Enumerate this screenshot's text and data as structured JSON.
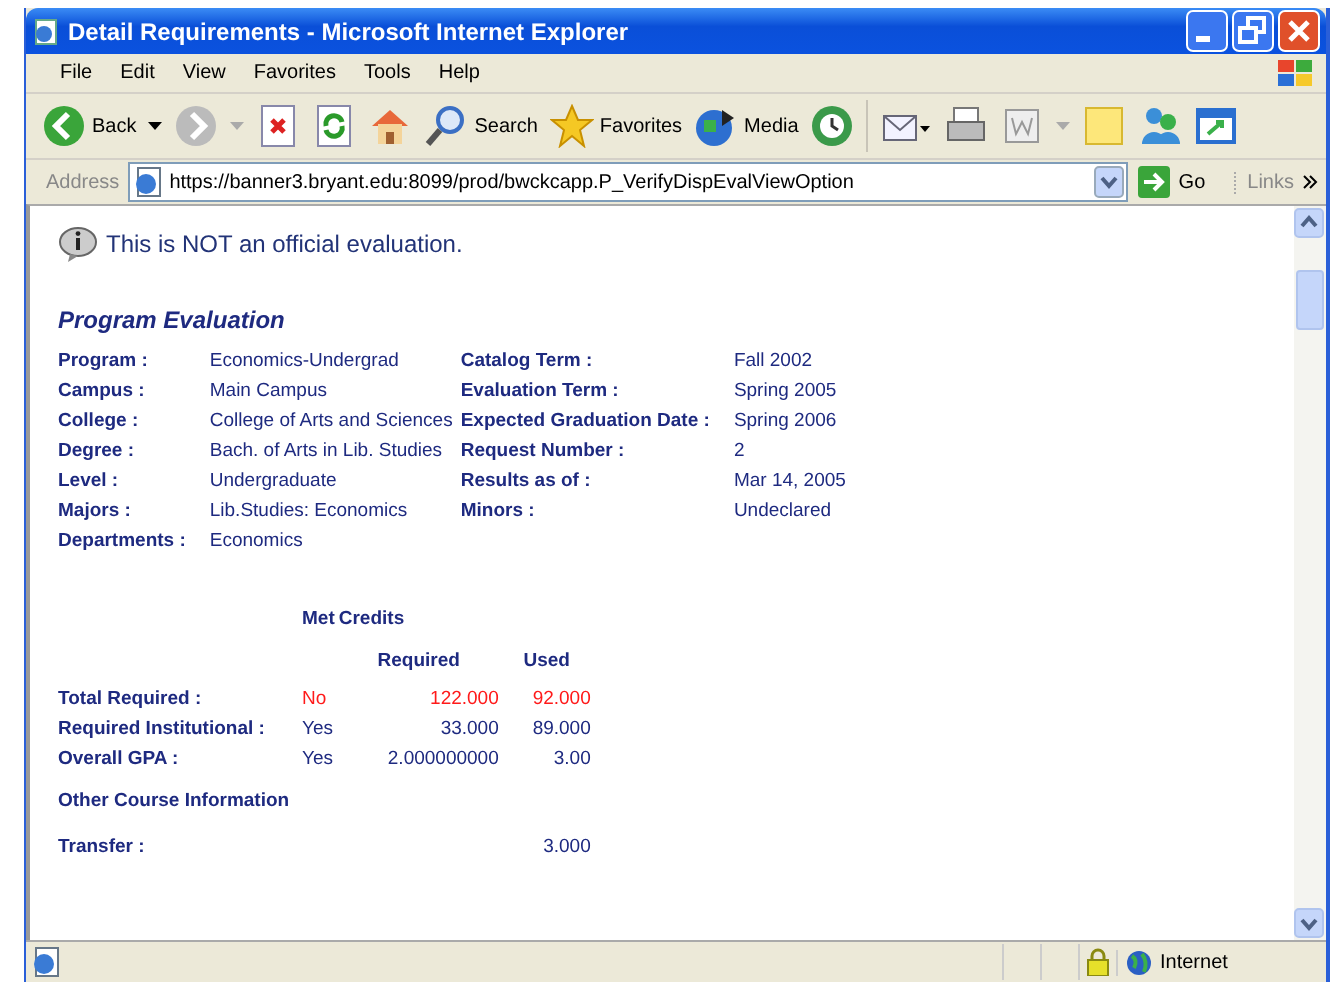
{
  "window": {
    "title": "Detail Requirements - Microsoft Internet Explorer"
  },
  "menu": [
    "File",
    "Edit",
    "View",
    "Favorites",
    "Tools",
    "Help"
  ],
  "toolbar": [
    {
      "kind": "back",
      "label": "Back"
    },
    {
      "kind": "forward"
    },
    {
      "kind": "stop"
    },
    {
      "kind": "refresh"
    },
    {
      "kind": "home"
    },
    {
      "kind": "search",
      "label": "Search"
    },
    {
      "kind": "favorites",
      "label": "Favorites"
    },
    {
      "kind": "media",
      "label": "Media"
    },
    {
      "kind": "history"
    },
    {
      "kind": "mail"
    },
    {
      "kind": "print"
    },
    {
      "kind": "edit"
    },
    {
      "kind": "note"
    },
    {
      "kind": "messenger"
    },
    {
      "kind": "window"
    }
  ],
  "address_bar": {
    "label": "Address",
    "value": "https://banner3.bryant.edu:8099/prod/bwckcapp.P_VerifyDispEvalViewOption",
    "go": "Go",
    "links": "Links"
  },
  "notice": "This is NOT an official evaluation.",
  "section_title": "Program Evaluation",
  "details": [
    {
      "label": "Program :",
      "value": "Economics-Undergrad",
      "label2": "Catalog Term :",
      "value2": "Fall 2002"
    },
    {
      "label": "Campus :",
      "value": "Main Campus",
      "label2": "Evaluation Term :",
      "value2": "Spring 2005"
    },
    {
      "label": "College :",
      "value": "College of Arts and Sciences",
      "label2": "Expected Graduation Date :",
      "value2": "Spring 2006"
    },
    {
      "label": "Degree :",
      "value": "Bach. of Arts in Lib. Studies",
      "label2": "Request Number :",
      "value2": "2"
    },
    {
      "label": "Level :",
      "value": "Undergraduate",
      "label2": "Results as of :",
      "value2": "Mar 14, 2005"
    },
    {
      "label": "Majors :",
      "value": "Lib.Studies: Economics",
      "label2": "Minors :",
      "value2": "Undeclared"
    },
    {
      "label": "Departments :",
      "value": "Economics"
    }
  ],
  "credits": {
    "headers": {
      "met": "Met",
      "credits": "Credits",
      "required": "Required",
      "used": "Used"
    },
    "rows": [
      {
        "label": "Total Required :",
        "met": "No",
        "required": "122.000",
        "used": "92.000",
        "failed": true
      },
      {
        "label": "Required Institutional :",
        "met": "Yes",
        "required": "33.000",
        "used": "89.000",
        "failed": false
      },
      {
        "label": "Overall GPA :",
        "met": "Yes",
        "required": "2.000000000",
        "used": "3.00",
        "failed": false
      }
    ]
  },
  "other_title": "Other Course Information",
  "other": [
    {
      "label": "Transfer :",
      "used": "3.000"
    }
  ],
  "status_bar": {
    "zone": "Internet"
  }
}
